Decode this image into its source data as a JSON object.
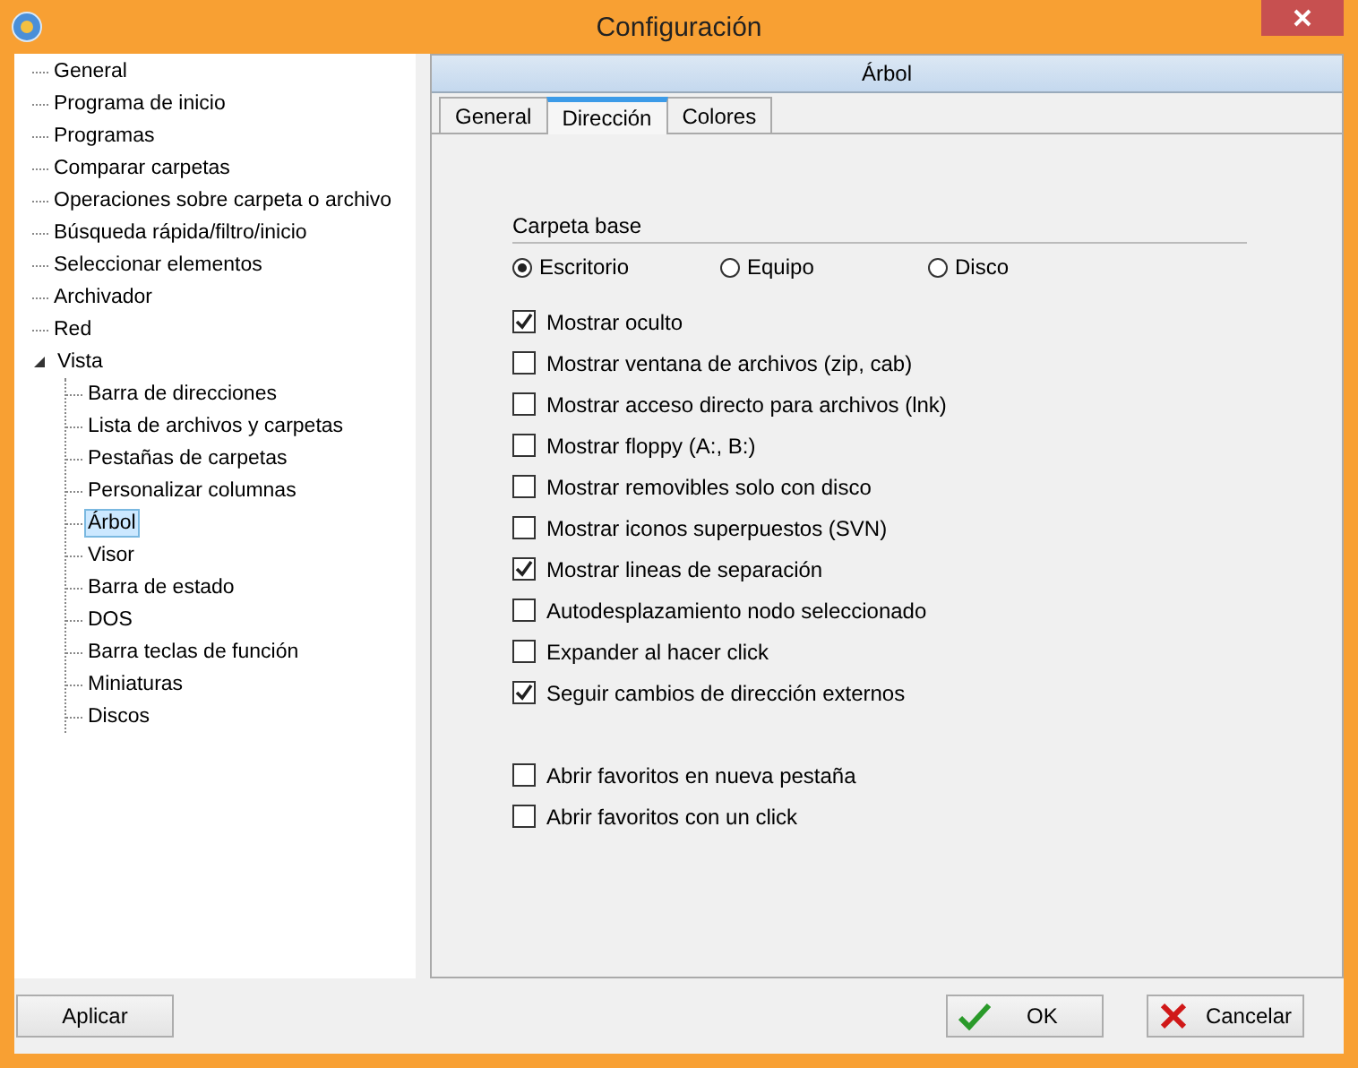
{
  "window": {
    "title": "Configuración"
  },
  "tree": [
    {
      "label": "General",
      "selected": false
    },
    {
      "label": "Programa de inicio",
      "selected": false
    },
    {
      "label": "Programas",
      "selected": false
    },
    {
      "label": "Comparar carpetas",
      "selected": false
    },
    {
      "label": "Operaciones sobre carpeta o archivo",
      "selected": false
    },
    {
      "label": "Búsqueda rápida/filtro/inicio",
      "selected": false
    },
    {
      "label": "Seleccionar elementos",
      "selected": false
    },
    {
      "label": "Archivador",
      "selected": false
    },
    {
      "label": "Red",
      "selected": false
    },
    {
      "label": "Vista",
      "selected": false,
      "expanded": true,
      "children": [
        {
          "label": "Barra de direcciones",
          "selected": false
        },
        {
          "label": "Lista de archivos y carpetas",
          "selected": false
        },
        {
          "label": "Pestañas de carpetas",
          "selected": false
        },
        {
          "label": "Personalizar columnas",
          "selected": false
        },
        {
          "label": "Árbol",
          "selected": true
        },
        {
          "label": "Visor",
          "selected": false
        },
        {
          "label": "Barra de estado",
          "selected": false
        },
        {
          "label": "DOS",
          "selected": false
        },
        {
          "label": "Barra teclas de función",
          "selected": false
        },
        {
          "label": "Miniaturas",
          "selected": false
        },
        {
          "label": "Discos",
          "selected": false
        }
      ]
    }
  ],
  "panel": {
    "title": "Árbol",
    "tabs": [
      {
        "label": "General",
        "selected": false
      },
      {
        "label": "Dirección",
        "selected": true
      },
      {
        "label": "Colores",
        "selected": false
      }
    ],
    "base_folder": {
      "label": "Carpeta base",
      "options": [
        {
          "label": "Escritorio",
          "selected": true
        },
        {
          "label": "Equipo",
          "selected": false
        },
        {
          "label": "Disco",
          "selected": false
        }
      ]
    },
    "checkbox_groups": [
      [
        {
          "label": "Mostrar oculto",
          "checked": true
        },
        {
          "label": "Mostrar ventana de archivos (zip, cab)",
          "checked": false
        },
        {
          "label": "Mostrar acceso directo para archivos (lnk)",
          "checked": false
        },
        {
          "label": "Mostrar floppy (A:, B:)",
          "checked": false
        },
        {
          "label": "Mostrar removibles solo con disco",
          "checked": false
        },
        {
          "label": "Mostrar iconos superpuestos (SVN)",
          "checked": false
        },
        {
          "label": "Mostrar lineas de separación",
          "checked": true
        },
        {
          "label": "Autodesplazamiento nodo seleccionado",
          "checked": false
        },
        {
          "label": "Expander al hacer click",
          "checked": false
        },
        {
          "label": "Seguir cambios de dirección externos",
          "checked": true
        }
      ],
      [
        {
          "label": "Abrir favoritos en nueva pestaña",
          "checked": false
        },
        {
          "label": "Abrir favoritos con un click",
          "checked": false
        }
      ]
    ]
  },
  "buttons": [
    {
      "label": "Aplicar",
      "kind": "plain"
    },
    {
      "label": "OK",
      "kind": "ok"
    },
    {
      "label": "Cancelar",
      "kind": "cancel"
    }
  ]
}
